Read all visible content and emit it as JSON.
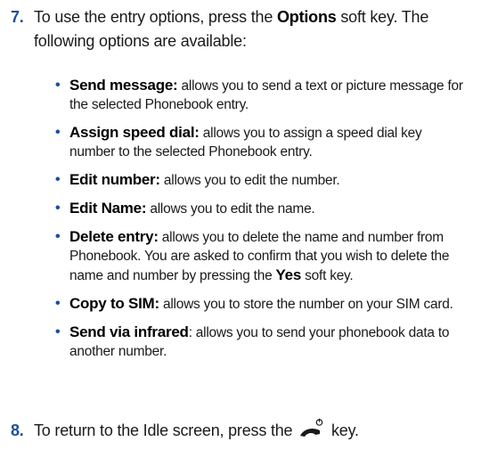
{
  "step7": {
    "number": "7.",
    "text_before": "To use the entry options, press the ",
    "bold": "Options",
    "text_after": " soft key. The following options are available:"
  },
  "options": [
    {
      "term": "Send message:",
      "desc": " allows you to send a text or picture message for the selected Phonebook entry."
    },
    {
      "term": "Assign speed dial:",
      "desc": " allows you to assign a speed dial key number to the selected Phonebook entry."
    },
    {
      "term": "Edit number:",
      "desc": " allows you to edit the number."
    },
    {
      "term": "Edit Name:",
      "desc": " allows you to edit the name."
    },
    {
      "term": "Delete entry:",
      "desc": " allows you to delete the name and number from Phonebook. You are asked to confirm that you wish to delete the name and number by pressing the ",
      "bold": "Yes",
      "desc_after": " soft key."
    },
    {
      "term": "Copy to SIM:",
      "desc": " allows you to store the number on your SIM card."
    },
    {
      "term": "Send via infrared",
      "desc": ": allows you to send your phonebook data to another number."
    }
  ],
  "step8": {
    "number": "8.",
    "text_before": "To return to the Idle screen, press the ",
    "icon": "end-call-power-key-icon",
    "text_after": " key."
  },
  "colors": {
    "accent": "#1b4f9c",
    "text": "#1a1a1a"
  }
}
